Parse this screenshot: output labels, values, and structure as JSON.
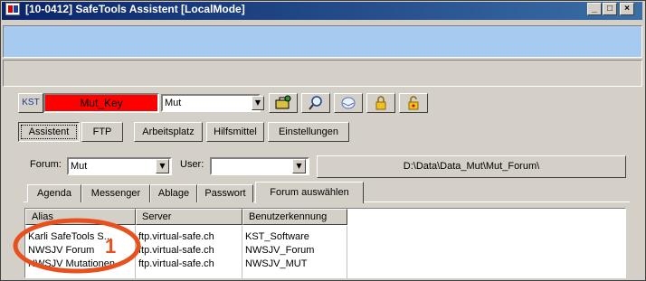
{
  "window": {
    "title": "[10-0412] SafeTools Assistent [LocalMode]",
    "controls": {
      "minimize": "_",
      "maximize": "□",
      "close": "×"
    }
  },
  "toolbar": {
    "kst_label": "KST",
    "key_field_value": "Mut_Key",
    "combo_value": "Mut",
    "icons": [
      "toolbox-icon",
      "search-icon",
      "mail-icon",
      "lock-icon",
      "unlock-icon"
    ]
  },
  "nav": {
    "items": [
      {
        "label": "Assistent",
        "pressed": true
      },
      {
        "label": "FTP",
        "pressed": false
      },
      {
        "label": "Arbeitsplatz",
        "pressed": false
      },
      {
        "label": "Hilfsmittel",
        "pressed": false
      },
      {
        "label": "Einstellungen",
        "pressed": false
      }
    ]
  },
  "filters": {
    "forum_label": "Forum:",
    "forum_value": "Mut",
    "user_label": "User:",
    "user_value": "",
    "path": "D:\\Data\\Data_Mut\\Mut_Forum\\"
  },
  "tabs": [
    {
      "label": "Agenda"
    },
    {
      "label": "Messenger"
    },
    {
      "label": "Ablage"
    },
    {
      "label": "Passwort"
    },
    {
      "label": "Forum auswählen",
      "active": true
    }
  ],
  "table": {
    "columns": [
      "Alias",
      "Server",
      "Benutzerkennung"
    ],
    "rows": [
      [
        "Karli SafeTools S...",
        "ftp.virtual-safe.ch",
        "KST_Software"
      ],
      [
        "NWSJV Forum",
        "ftp.virtual-safe.ch",
        "NWSJV_Forum"
      ],
      [
        "NWSJV Mutationen",
        "ftp.virtual-safe.ch",
        "NWSJV_MUT"
      ]
    ]
  },
  "annotation": {
    "number": "1",
    "color": "#e8501e"
  },
  "colors": {
    "titlebar": "#0a246a",
    "accent_bar": "#a6caf0",
    "key_field": "#ff0000"
  }
}
